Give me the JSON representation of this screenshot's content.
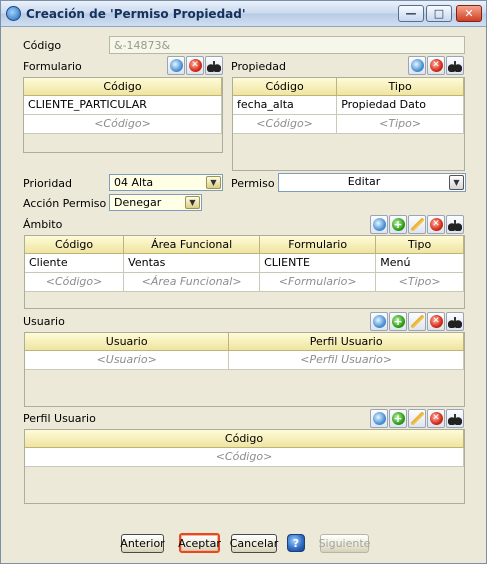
{
  "window": {
    "title": "Creación de 'Permiso Propiedad'",
    "buttons": {
      "minimize": "—",
      "maximize": "□",
      "close": "✕"
    }
  },
  "codigo": {
    "label": "Código",
    "value": "&-14873&"
  },
  "formulario": {
    "label": "Formulario",
    "columns": [
      "Código"
    ],
    "rows": [
      [
        "CLIENTE_PARTICULAR"
      ]
    ],
    "placeholder_row": [
      "<Código>"
    ],
    "tools": [
      "search-icon",
      "delete-icon",
      "binoculars-icon"
    ]
  },
  "propiedad": {
    "label": "Propiedad",
    "columns": [
      "Código",
      "Tipo"
    ],
    "rows": [
      [
        "fecha_alta",
        "Propiedad Dato"
      ]
    ],
    "placeholder_row": [
      "<Código>",
      "<Tipo>"
    ],
    "tools": [
      "search-icon",
      "delete-icon",
      "binoculars-icon"
    ]
  },
  "prioridad": {
    "label": "Prioridad",
    "value": "04 Alta"
  },
  "permiso": {
    "label": "Permiso",
    "value": "Editar"
  },
  "accion_permiso": {
    "label": "Acción Permiso",
    "value": "Denegar"
  },
  "ambito": {
    "label": "Ámbito",
    "columns": [
      "Código",
      "Área Funcional",
      "Formulario",
      "Tipo"
    ],
    "rows": [
      [
        "Cliente",
        "Ventas",
        "CLIENTE",
        "Menú"
      ]
    ],
    "placeholder_row": [
      "<Código>",
      "<Área Funcional>",
      "<Formulario>",
      "<Tipo>"
    ],
    "tools": [
      "search-icon",
      "add-icon",
      "edit-icon",
      "delete-icon",
      "binoculars-icon"
    ]
  },
  "usuario": {
    "label": "Usuario",
    "columns": [
      "Usuario",
      "Perfil Usuario"
    ],
    "placeholder_row": [
      "<Usuario>",
      "<Perfil Usuario>"
    ],
    "tools": [
      "search-icon",
      "add-icon",
      "edit-icon",
      "delete-icon",
      "binoculars-icon"
    ]
  },
  "perfil_usuario": {
    "label": "Perfil Usuario",
    "columns": [
      "Código"
    ],
    "placeholder_row": [
      "<Código>"
    ],
    "tools": [
      "search-icon",
      "add-icon",
      "edit-icon",
      "delete-icon",
      "binoculars-icon"
    ]
  },
  "footer": {
    "anterior": "Anterior",
    "aceptar": "Aceptar",
    "cancelar": "Cancelar",
    "help": "?",
    "siguiente": "Siguiente"
  },
  "colors": {
    "window_bg": "#ECE9D8",
    "header_bg": "#efe4a1",
    "accent": "#e24a1f"
  }
}
